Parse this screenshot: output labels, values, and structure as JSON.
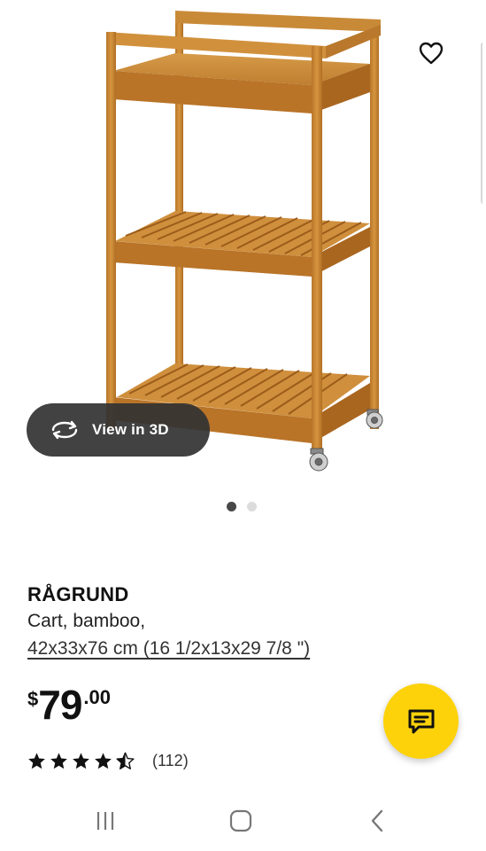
{
  "product": {
    "name": "RÅGRUND",
    "description": "Cart, bamboo,",
    "size": "42x33x76 cm (16 1/2x13x29 7/8 \")"
  },
  "price": {
    "currency": "$",
    "integer": "79",
    "decimal": ".00"
  },
  "rating": {
    "stars": 4.5,
    "max_stars": 5,
    "count": "(112)"
  },
  "gallery": {
    "view_3d_label": "View in 3D",
    "image_count": 2,
    "active_image": 1
  },
  "icons": {
    "favorite": "heart-outline-icon",
    "view_3d": "rotate-3d-icon",
    "chat": "chat-bubble-icon",
    "nav_recents": "recent-apps-icon",
    "nav_home": "home-icon",
    "nav_back": "back-icon"
  },
  "colors": {
    "accent_yellow": "#fdd20a",
    "dark_pill": "#323232",
    "bamboo": "#c8872e",
    "text": "#111111"
  }
}
